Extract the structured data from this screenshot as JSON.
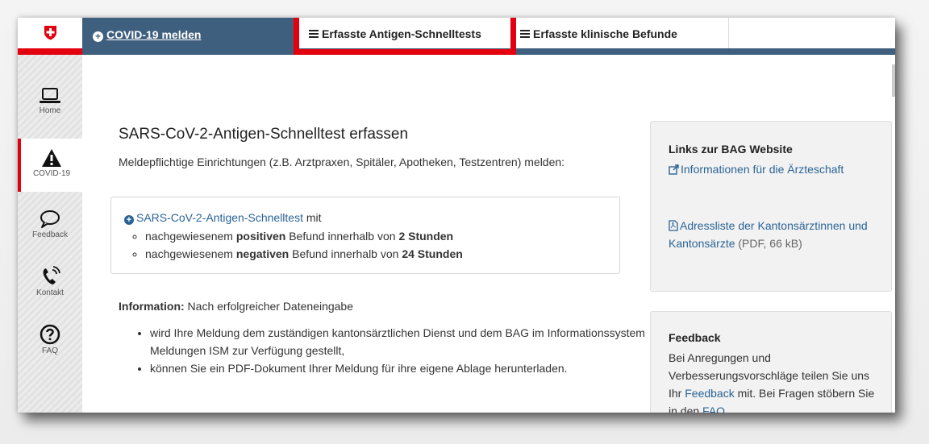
{
  "topbar": {
    "covid_link": "COVID-19 melden",
    "tab_antigen": "Erfasste Antigen-Schnelltests",
    "tab_klinisch": "Erfasste klinische Befunde"
  },
  "sidebar": {
    "items": [
      {
        "label": "Home",
        "icon": "laptop-icon"
      },
      {
        "label": "COVID-19",
        "icon": "warning-icon"
      },
      {
        "label": "Feedback",
        "icon": "speech-bubble-icon"
      },
      {
        "label": "Kontakt",
        "icon": "phone-icon"
      },
      {
        "label": "FAQ",
        "icon": "question-icon"
      }
    ]
  },
  "main": {
    "title": "SARS-CoV-2-Antigen-Schnelltest erfassen",
    "intro": "Meldepflichtige Einrichtungen (z.B. Arztpraxen, Spitäler, Apotheken, Testzentren) melden:",
    "box": {
      "link": "SARS-CoV-2-Antigen-Schnelltest",
      "link_suffix": "mit",
      "item1_pre": "nachgewiesenem ",
      "item1_bold": "positiven",
      "item1_mid": " Befund innerhalb von ",
      "item1_time": "2 Stunden",
      "item2_pre": "nachgewiesenem ",
      "item2_bold": "negativen",
      "item2_mid": " Befund innerhalb von ",
      "item2_time": "24 Stunden"
    },
    "info_label": "Information:",
    "info_text": " Nach erfolgreicher Dateneingabe",
    "info_items": [
      "wird Ihre Meldung dem zuständigen kantonsärztlichen Dienst und dem BAG im Informationssystem Meldungen ISM zur Verfügung gestellt,",
      "können Sie ein PDF-Dokument Ihrer Meldung für ihre eigene Ablage herunterladen."
    ]
  },
  "panel_links": {
    "title": "Links zur BAG Website",
    "link1": "Informationen für die Ärzteschaft",
    "link2": "Adressliste der Kantonsärztinnen und Kantonsärzte",
    "link2_note": " (PDF, 66 kB)"
  },
  "panel_feedback": {
    "title": "Feedback",
    "text1": "Bei Anregungen und Verbesserungsvorschläge teilen Sie uns Ihr ",
    "feedback_link": "Feedback",
    "text2": " mit. Bei Fragen stöbern Sie in den ",
    "faq_link": "FAQ",
    "text3": "."
  },
  "colors": {
    "brand_red": "#e3000f",
    "nav_blue": "#3f5f7f",
    "link_blue": "#2a6496"
  }
}
